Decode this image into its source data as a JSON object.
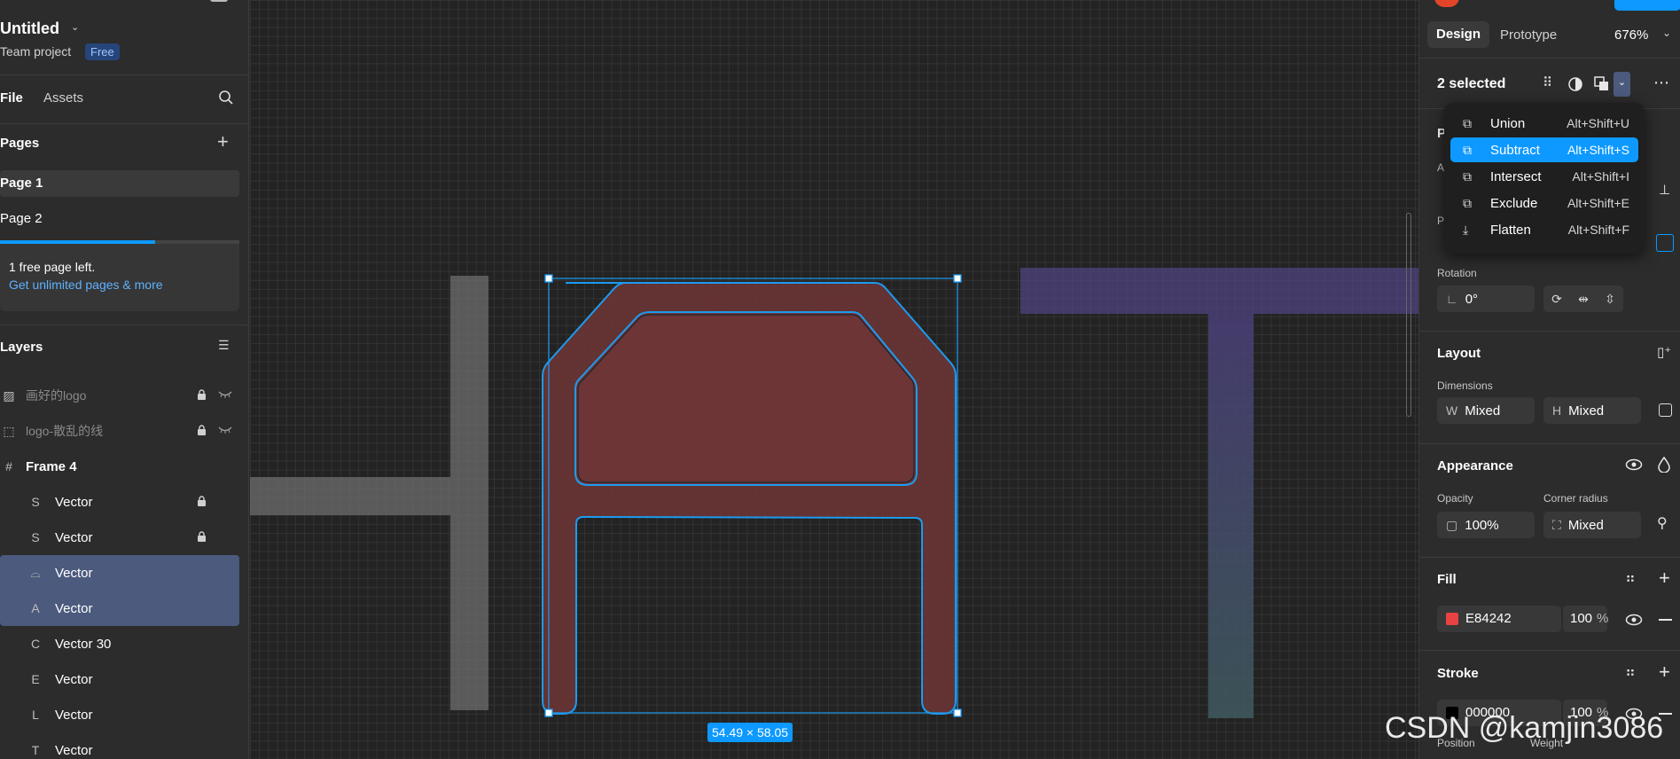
{
  "file": {
    "title": "Untitled",
    "team": "Team project",
    "plan_badge": "Free"
  },
  "left_tabs": {
    "file": "File",
    "assets": "Assets"
  },
  "pages": {
    "heading": "Pages",
    "items": [
      "Page 1",
      "Page 2"
    ],
    "notice_line1": "1 free page left.",
    "notice_link": "Get unlimited pages & more"
  },
  "layers": {
    "heading": "Layers",
    "items": [
      {
        "name": "画好的logo",
        "icon": "hidden-image-icon",
        "glyph": "▨",
        "locked": true,
        "hidden": true,
        "selected": false,
        "dim": true
      },
      {
        "name": "logo-散乱的线",
        "icon": "dashed-frame-icon",
        "glyph": "⬚",
        "locked": true,
        "hidden": true,
        "selected": false,
        "dim": true
      },
      {
        "name": "Frame 4",
        "icon": "frame-icon",
        "glyph": "#",
        "locked": false,
        "hidden": false,
        "selected": false,
        "bold": true
      },
      {
        "name": "Vector",
        "icon": "vector-s-icon",
        "glyph": "S",
        "locked": true,
        "hidden": false,
        "selected": false
      },
      {
        "name": "Vector",
        "icon": "vector-s-icon",
        "glyph": "S",
        "locked": true,
        "hidden": false,
        "selected": false
      },
      {
        "name": "Vector",
        "icon": "vector-shape-icon",
        "glyph": "⌓",
        "locked": false,
        "hidden": false,
        "selected": true
      },
      {
        "name": "Vector",
        "icon": "vector-a-icon",
        "glyph": "A",
        "locked": false,
        "hidden": false,
        "selected": true
      },
      {
        "name": "Vector 30",
        "icon": "vector-c-icon",
        "glyph": "C",
        "locked": false,
        "hidden": false,
        "selected": false
      },
      {
        "name": "Vector",
        "icon": "vector-e-icon",
        "glyph": "E",
        "locked": false,
        "hidden": false,
        "selected": false
      },
      {
        "name": "Vector",
        "icon": "vector-l-icon",
        "glyph": "L",
        "locked": false,
        "hidden": false,
        "selected": false
      },
      {
        "name": "Vector",
        "icon": "vector-t-icon",
        "glyph": "T",
        "locked": false,
        "hidden": false,
        "selected": false
      }
    ]
  },
  "canvas": {
    "dimension_label": "54.49 × 58.05"
  },
  "right": {
    "tabs": {
      "design": "Design",
      "prototype": "Prototype"
    },
    "zoom": "676%",
    "selection_count": "2 selected",
    "rotation_label": "Rotation",
    "rotation_value": "0°",
    "layout": {
      "title": "Layout",
      "dimensions_label": "Dimensions",
      "w_prefix": "W",
      "w_value": "Mixed",
      "h_prefix": "H",
      "h_value": "Mixed"
    },
    "appearance": {
      "title": "Appearance",
      "opacity_label": "Opacity",
      "opacity_value": "100%",
      "radius_label": "Corner radius",
      "radius_value": "Mixed"
    },
    "fill": {
      "title": "Fill",
      "hex": "E84242",
      "opacity": "100",
      "unit": "%",
      "color": "#E84242"
    },
    "stroke": {
      "title": "Stroke",
      "hex": "000000",
      "opacity": "100",
      "unit": "%",
      "color": "#000000",
      "position_label": "Position",
      "weight_label": "Weight"
    },
    "hidden_letters": {
      "a": "A",
      "p1": "P",
      "p2": "P"
    }
  },
  "boolean_menu": {
    "items": [
      {
        "label": "Union",
        "shortcut": "Alt+Shift+U",
        "icon": "union-icon",
        "glyph": "⧉",
        "active": false
      },
      {
        "label": "Subtract",
        "shortcut": "Alt+Shift+S",
        "icon": "subtract-icon",
        "glyph": "⧉",
        "active": true
      },
      {
        "label": "Intersect",
        "shortcut": "Alt+Shift+I",
        "icon": "intersect-icon",
        "glyph": "⧉",
        "active": false
      },
      {
        "label": "Exclude",
        "shortcut": "Alt+Shift+E",
        "icon": "exclude-icon",
        "glyph": "⧉",
        "active": false
      },
      {
        "label": "Flatten",
        "shortcut": "Alt+Shift+F",
        "icon": "flatten-icon",
        "glyph": "⤓",
        "active": false
      }
    ]
  },
  "watermark": "CSDN @kamjin3086",
  "colors": {
    "accent": "#0d99ff",
    "selection_row": "#4b5a7d",
    "shape_fill": "#6e3535",
    "shape_stroke": "#1c9bf0",
    "t_shape": "#4a4070",
    "badge_bg": "#26457a"
  }
}
